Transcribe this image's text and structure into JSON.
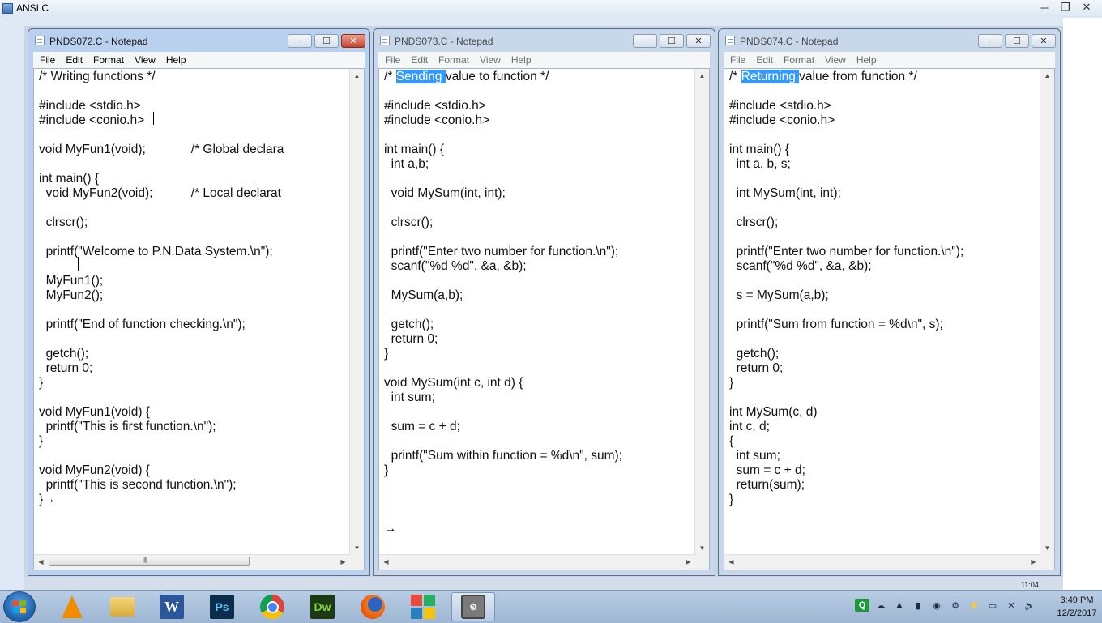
{
  "outer_window": {
    "title": "ANSI C",
    "bottom_clock": "11:04",
    "controls": {
      "minimize": "─",
      "maximize": "❐",
      "close": "✕"
    }
  },
  "notepads": [
    {
      "title": "PNDS072.C - Notepad",
      "menu": [
        "File",
        "Edit",
        "Format",
        "View",
        "Help"
      ],
      "lines": [
        "/* Writing functions */",
        "",
        "#include <stdio.h>",
        "#include <conio.h>",
        "",
        "void MyFun1(void);             /* Global declara",
        "",
        "int main() {",
        "  void MyFun2(void);           /* Local declarat",
        "",
        "  clrscr();",
        "",
        "  printf(\"Welcome to P.N.Data System.\\n\");",
        "",
        "  MyFun1();",
        "  MyFun2();",
        "",
        "  printf(\"End of function checking.\\n\");",
        "",
        "  getch();",
        "  return 0;",
        "}",
        "",
        "void MyFun1(void) {",
        "  printf(\"This is first function.\\n\");",
        "}",
        "",
        "void MyFun2(void) {",
        "  printf(\"This is second function.\\n\");",
        "}→"
      ]
    },
    {
      "title": "PNDS073.C - Notepad",
      "menu": [
        "File",
        "Edit",
        "Format",
        "View",
        "Help"
      ],
      "highlight": "Sending",
      "lines": [
        "/* Sending value to function */",
        "",
        "#include <stdio.h>",
        "#include <conio.h>",
        "",
        "int main() {",
        "  int a,b;",
        "",
        "  void MySum(int, int);",
        "",
        "  clrscr();",
        "",
        "  printf(\"Enter two number for function.\\n\");",
        "  scanf(\"%d %d\", &a, &b);",
        "",
        "  MySum(a,b);",
        "",
        "  getch();",
        "  return 0;",
        "}",
        "",
        "void MySum(int c, int d) {",
        "  int sum;",
        "",
        "  sum = c + d;",
        "",
        "  printf(\"Sum within function = %d\\n\", sum);",
        "}",
        "",
        "",
        "",
        "→"
      ]
    },
    {
      "title": "PNDS074.C - Notepad",
      "menu": [
        "File",
        "Edit",
        "Format",
        "View",
        "Help"
      ],
      "highlight": "Returning",
      "lines": [
        "/* Returning value from function */",
        "",
        "#include <stdio.h>",
        "#include <conio.h>",
        "",
        "int main() {",
        "  int a, b, s;",
        "",
        "  int MySum(int, int);",
        "",
        "  clrscr();",
        "",
        "  printf(\"Enter two number for function.\\n\");",
        "  scanf(\"%d %d\", &a, &b);",
        "",
        "  s = MySum(a,b);",
        "",
        "  printf(\"Sum from function = %d\\n\", s);",
        "",
        "  getch();",
        "  return 0;",
        "}",
        "",
        "int MySum(c, d)",
        "int c, d;",
        "{",
        "  int sum;",
        "  sum = c + d;",
        "  return(sum);",
        "}"
      ]
    }
  ],
  "taskbar": {
    "apps": [
      {
        "name": "vlc-icon",
        "label": ""
      },
      {
        "name": "folder-icon",
        "label": ""
      },
      {
        "name": "word-icon",
        "label": "W"
      },
      {
        "name": "photoshop-icon",
        "label": "Ps"
      },
      {
        "name": "chrome-icon",
        "label": ""
      },
      {
        "name": "dreamweaver-icon",
        "label": "Dw"
      },
      {
        "name": "firefox-icon",
        "label": ""
      },
      {
        "name": "office-icon",
        "label": ""
      },
      {
        "name": "tool-icon",
        "label": "⚙"
      }
    ],
    "tray_icons": [
      "Q",
      "☁",
      "▲",
      "▮",
      "◉",
      "⚙",
      "⚡",
      "▭",
      "✕",
      "🔈"
    ],
    "time": "3:49 PM",
    "date": "12/2/2017"
  },
  "colors": {
    "selection": "#3399ff",
    "close_active": "#c8452d"
  }
}
